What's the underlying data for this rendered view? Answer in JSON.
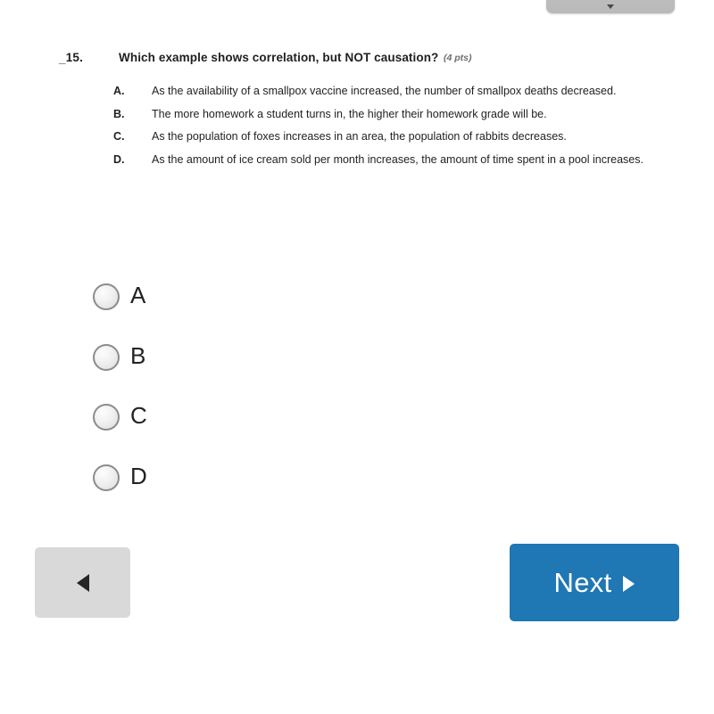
{
  "toolbar": {
    "chip_icon": "chevron-down-icon"
  },
  "question": {
    "lead_mark": "_",
    "number": "15.",
    "prompt": "Which example shows correlation, but NOT causation?",
    "points": "(4 pts)",
    "choices": [
      {
        "letter": "A.",
        "text": "As the availability of a smallpox vaccine increased, the number of smallpox deaths decreased."
      },
      {
        "letter": "B.",
        "text": "The more homework a student turns in, the higher their homework grade will be."
      },
      {
        "letter": "C.",
        "text": "As the population of foxes increases in an area, the population of rabbits decreases."
      },
      {
        "letter": "D.",
        "text": "As the amount of ice cream sold per month increases, the amount of time spent in a pool increases."
      }
    ]
  },
  "answers": {
    "options": [
      {
        "label": "A",
        "selected": false
      },
      {
        "label": "B",
        "selected": false
      },
      {
        "label": "C",
        "selected": false
      },
      {
        "label": "D",
        "selected": false
      }
    ]
  },
  "navigation": {
    "prev_icon": "triangle-left-icon",
    "next_label": "Next",
    "next_icon": "triangle-right-icon"
  },
  "colors": {
    "page_background": "#ffffff",
    "next_button": "#1f77b4",
    "prev_button": "#d9d9d9",
    "radio_border": "#8c8c8c",
    "text": "#1f1f1f",
    "points_text": "#6d6d6d",
    "top_chip": "#bdbdbd"
  }
}
